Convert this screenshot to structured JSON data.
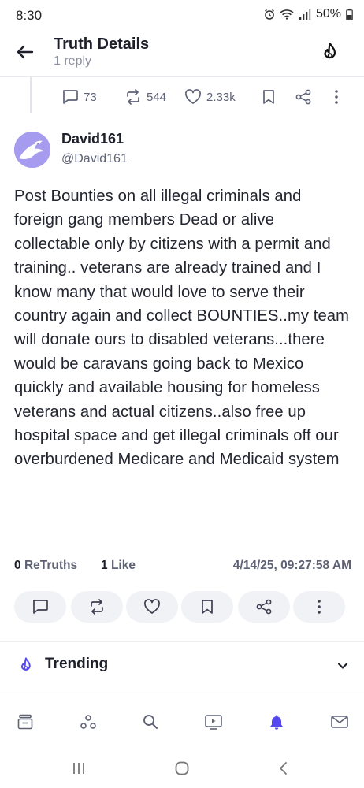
{
  "status_bar": {
    "time": "8:30",
    "battery": "50%"
  },
  "header": {
    "title": "Truth Details",
    "subtitle": "1 reply"
  },
  "parent_stats": {
    "replies": "73",
    "retruths": "544",
    "likes": "2.33k"
  },
  "author": {
    "name": "David161",
    "handle": "@David161"
  },
  "post": {
    "text": "Post Bounties on all illegal criminals and foreign gang members Dead or alive collectable only by citizens with a permit and training.. veterans are already trained and I know many that would love to serve their country again and collect BOUNTIES..my team will donate ours to disabled veterans...there would be caravans going back to Mexico quickly and available housing for homeless veterans and actual citizens..also free up hospital space and get illegal criminals off our overburdened Medicare and Medicaid system"
  },
  "meta": {
    "retruths_count": "0",
    "retruths_label": "ReTruths",
    "likes_count": "1",
    "likes_label": "Like",
    "timestamp": "4/14/25, 09:27:58 AM"
  },
  "trending": {
    "label": "Trending"
  },
  "colors": {
    "accent": "#5448ee",
    "text": "#1d1f2a",
    "muted": "#5e6275"
  },
  "icons": {
    "actions": [
      "comment-icon",
      "retruth-icon",
      "heart-icon",
      "bookmark-icon",
      "share-icon",
      "more-icon"
    ],
    "tabs": [
      "home-icon",
      "groups-icon",
      "search-icon",
      "video-icon",
      "notifications-icon",
      "messages-icon"
    ],
    "active_tab": "notifications-icon"
  }
}
